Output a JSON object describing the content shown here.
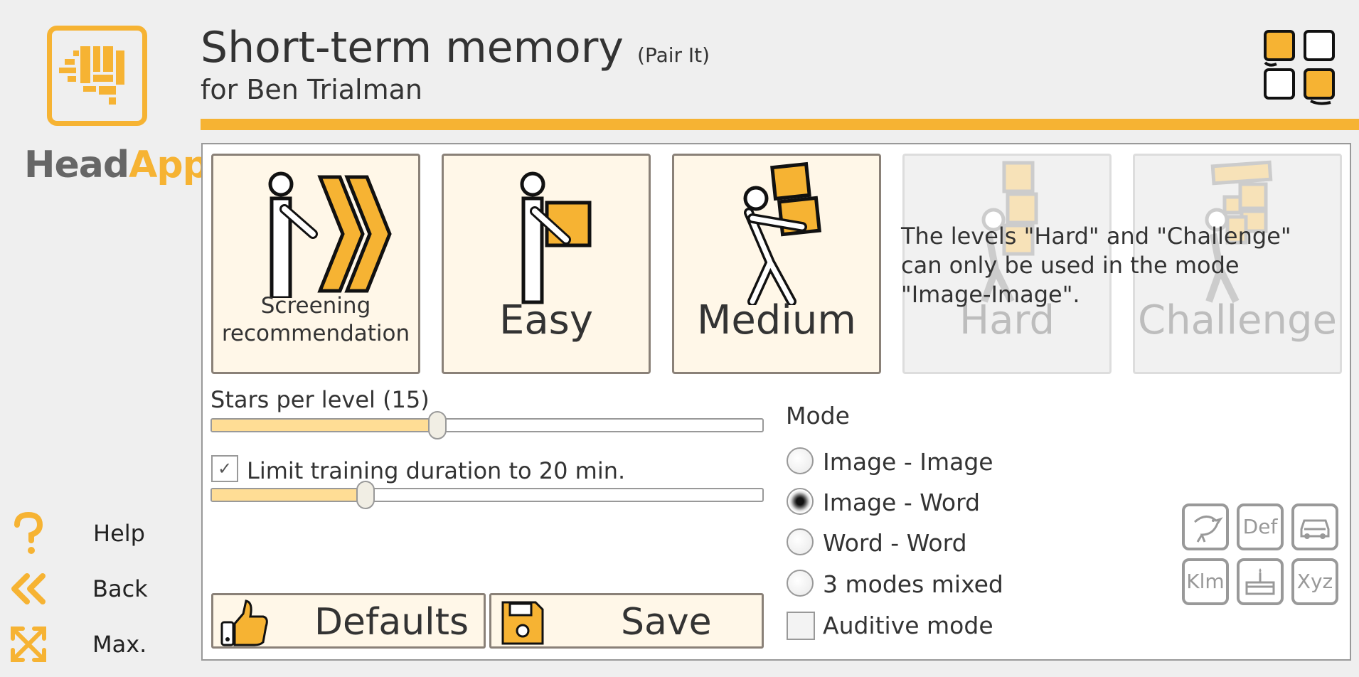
{
  "app": {
    "logo_text_head": "Head",
    "logo_text_app": "App",
    "brand_color": "#f6b333"
  },
  "header": {
    "title": "Short-term memory",
    "title_suffix": "(Pair It)",
    "subtitle": "for Ben Trialman"
  },
  "levels": [
    {
      "label": "Screening recommendation",
      "enabled": true
    },
    {
      "label": "Easy",
      "enabled": true
    },
    {
      "label": "Medium",
      "enabled": true
    },
    {
      "label": "Hard",
      "enabled": false
    },
    {
      "label": "Challenge",
      "enabled": false
    }
  ],
  "level_note": "The levels \"Hard\" and \"Challenge\" can only be used in the mode \"Image-Image\".",
  "settings": {
    "stars_label": "Stars per level (15)",
    "stars_fraction": 0.41,
    "limit_label": "Limit training duration to 20 min.",
    "limit_checked": true,
    "limit_check_glyph": "✓",
    "duration_fraction": 0.28
  },
  "mode": {
    "title": "Mode",
    "options": [
      "Image - Image",
      "Image - Word",
      "Word - Word",
      "3 modes mixed"
    ],
    "selected": "Image - Word",
    "auditive_label": "Auditive mode",
    "auditive_checked": false
  },
  "buttons": {
    "defaults_label": "Defaults",
    "save_label": "Save"
  },
  "nav": {
    "help": "Help",
    "back": "Back",
    "max": "Max."
  },
  "symbols": [
    "bird-icon",
    "Def",
    "car-icon",
    "Klm",
    "cake-icon",
    "Xyz"
  ]
}
